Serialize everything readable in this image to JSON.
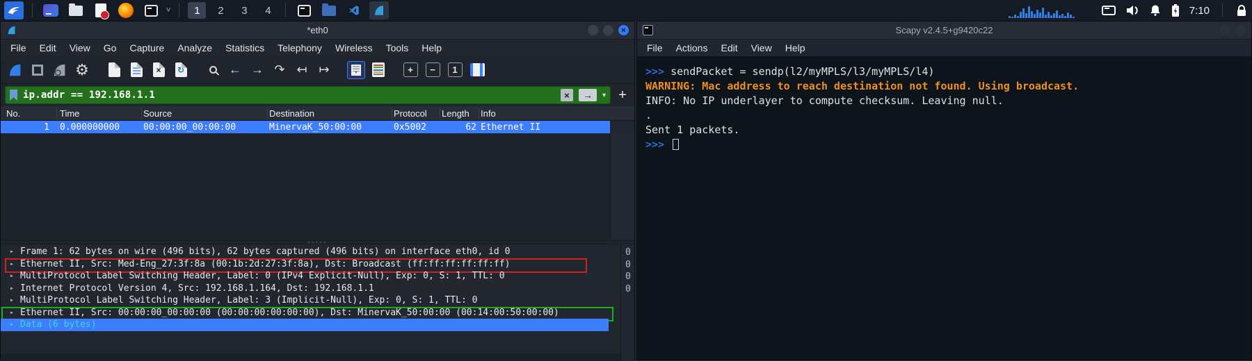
{
  "taskbar": {
    "workspaces": [
      "1",
      "2",
      "3",
      "4"
    ],
    "clock": "7:10"
  },
  "wireshark": {
    "title": "*eth0",
    "menu": [
      "File",
      "Edit",
      "View",
      "Go",
      "Capture",
      "Analyze",
      "Statistics",
      "Telephony",
      "Wireless",
      "Tools",
      "Help"
    ],
    "window_buttons": {
      "close": "×"
    },
    "toolbar_glyphs": {
      "gear": "⚙",
      "close_mark": "×",
      "reload_mark": "↻",
      "back": "←",
      "forward": "→",
      "goto": "↷",
      "first": "↤",
      "last": "↦",
      "autoscroll_caret": "▼",
      "zoom_in": "+",
      "zoom_out": "−",
      "zoom_normal": "1"
    },
    "filter": {
      "value": "ip.addr == 192.168.1.1",
      "clear": "×",
      "apply": "→",
      "dropdown": "▾",
      "add": "+"
    },
    "packet_list": {
      "columns": [
        "No.",
        "Time",
        "Source",
        "Destination",
        "Protocol",
        "Length",
        "Info"
      ],
      "rows": [
        {
          "no": "1",
          "time": "0.000000000",
          "source": "00:00:00_00:00:00",
          "destination": "MinervaK_50:00:00",
          "protocol": "0x5002",
          "length": "62",
          "info": "Ethernet II"
        }
      ]
    },
    "splitter_dots": "·····",
    "expand_arrow": "▸",
    "details": [
      {
        "text": "Frame 1: 62 bytes on wire (496 bits), 62 bytes captured (496 bits) on interface eth0, id 0"
      },
      {
        "text": "Ethernet II, Src: Med-Eng_27:3f:8a (00:1b:2d:27:3f:8a), Dst: Broadcast (ff:ff:ff:ff:ff:ff)"
      },
      {
        "text": "MultiProtocol Label Switching Header, Label: 0 (IPv4 Explicit-Null), Exp: 0, S: 1, TTL: 0"
      },
      {
        "text": "Internet Protocol Version 4, Src: 192.168.1.164, Dst: 192.168.1.1"
      },
      {
        "text": "MultiProtocol Label Switching Header, Label: 3 (Implicit-Null), Exp: 0, S: 1, TTL: 0"
      },
      {
        "text": "Ethernet II, Src: 00:00:00_00:00:00 (00:00:00:00:00:00), Dst: MinervaK_50:00:00 (00:14:00:50:00:00)"
      },
      {
        "text": "Data (6 bytes)"
      }
    ],
    "hex_pane": {
      "offsets": [
        "0",
        "0",
        "0",
        "0"
      ]
    }
  },
  "scapy": {
    "title": "Scapy v2.4.5+g9420c22",
    "menu": [
      "File",
      "Actions",
      "Edit",
      "View",
      "Help"
    ],
    "terminal": {
      "prompt": ">>> ",
      "lines": [
        {
          "text": "sendPacket = sendp(l2/myMPLS/l3/myMPLS/l4)"
        },
        {
          "text": "WARNING: Mac address to reach destination not found. Using broadcast."
        },
        {
          "text": "INFO: No IP underlayer to compute checksum. Leaving null."
        },
        {
          "text": "."
        },
        {
          "text": "Sent 1 packets."
        }
      ]
    }
  },
  "colors": {
    "accent_blue": "#3d7dff",
    "filter_green": "#24701f",
    "warning_orange": "#ee8f1e",
    "selected_cyan": "#3fd6d6",
    "red_box": "#d21f1f",
    "green_box": "#18b218",
    "prompt_blue": "#2e6bd6"
  }
}
